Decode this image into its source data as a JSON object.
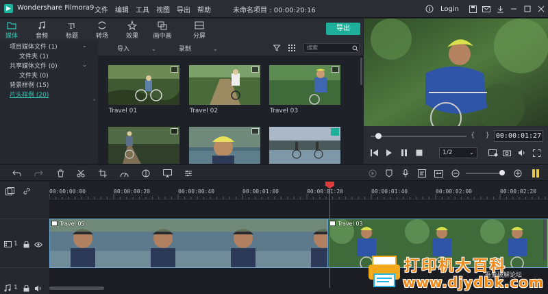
{
  "app": {
    "name": "Wondershare Filmora9",
    "project_title": "未命名项目 : 00:00:20:16",
    "login": "Login"
  },
  "menu": [
    "文件",
    "编辑",
    "工具",
    "视图",
    "导出",
    "帮助"
  ],
  "tabs": [
    {
      "label": "媒体",
      "icon": "folder-icon"
    },
    {
      "label": "音频",
      "icon": "music-note-icon"
    },
    {
      "label": "标题",
      "icon": "title-text-icon"
    },
    {
      "label": "转场",
      "icon": "transition-icon"
    },
    {
      "label": "效果",
      "icon": "effects-icon"
    },
    {
      "label": "画中画",
      "icon": "pip-icon"
    },
    {
      "label": "分屏",
      "icon": "split-screen-icon"
    }
  ],
  "export_label": "导出",
  "library": [
    {
      "label": "项目媒体文件 (1)",
      "level": 0,
      "expanded": true
    },
    {
      "label": "文件夹 (1)",
      "level": 1
    },
    {
      "label": "共享媒体文件 (0)",
      "level": 0,
      "expanded": true
    },
    {
      "label": "文件夹 (0)",
      "level": 1
    },
    {
      "label": "背景样例 (15)",
      "level": 0
    },
    {
      "label": "片头样例 (20)",
      "level": 0,
      "selected": true
    }
  ],
  "media_toolbar": {
    "import": "导入",
    "record": "录制",
    "search_placeholder": "搜索"
  },
  "media_items": [
    {
      "label": "Travel 01"
    },
    {
      "label": "Travel 02"
    },
    {
      "label": "Travel 03"
    },
    {
      "label": ""
    },
    {
      "label": ""
    },
    {
      "label": ""
    }
  ],
  "player": {
    "timecode": "00:00:01:27",
    "ratio": "1/2",
    "progress": 0.05
  },
  "ruler_ticks": [
    "00:00:00:00",
    "00:00:00:20",
    "00:00:00:40",
    "00:00:01:00",
    "00:00:01:20",
    "00:00:01:40",
    "00:00:02:00",
    "00:00:02:20"
  ],
  "tracks": {
    "video": {
      "label": "1",
      "clips": [
        "Travel 05",
        "Travel 03"
      ]
    },
    "audio": {
      "label": "1"
    }
  },
  "watermark": {
    "line1": "打印机大百科",
    "line2": "www.djydbk.com",
    "line3": "吾爱破解论坛"
  },
  "colors": {
    "accent": "#1eaf9a",
    "selection": "#39c5b6",
    "playhead": "#e23b3b",
    "clip_border": "#6ba7d8",
    "watermark": "#f28a1a"
  }
}
